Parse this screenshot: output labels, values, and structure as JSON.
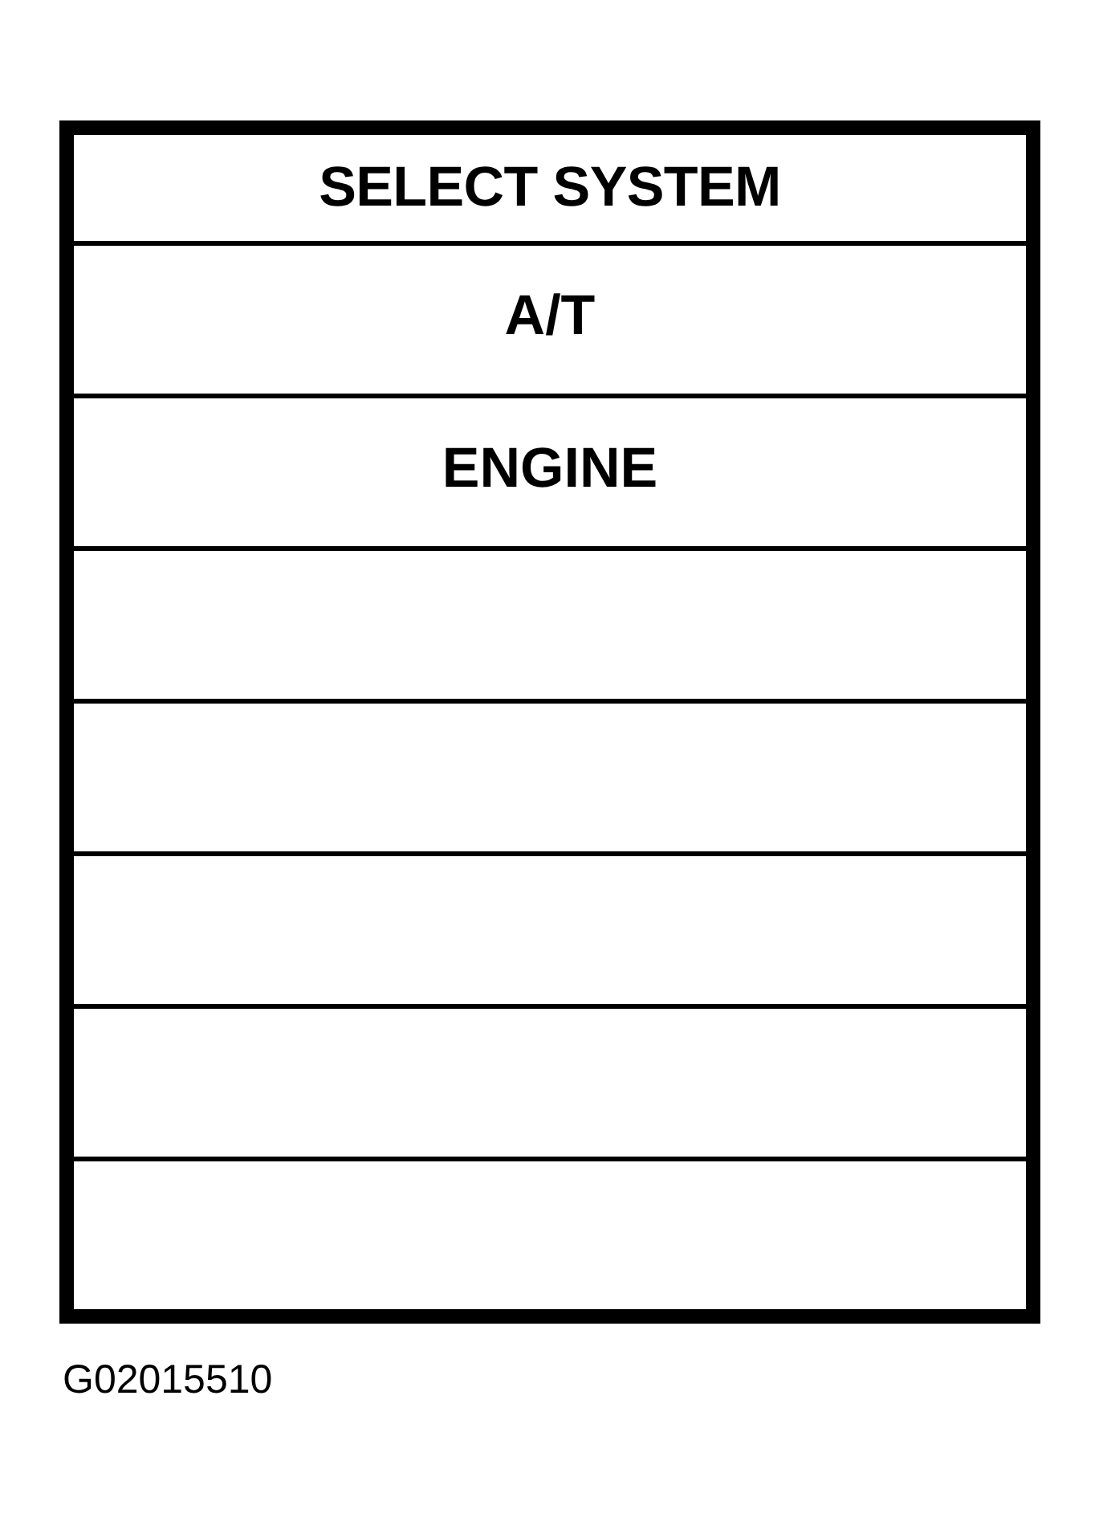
{
  "menu": {
    "title": "SELECT SYSTEM",
    "items": [
      {
        "kind": "option",
        "label": "A/T"
      },
      {
        "kind": "option",
        "label": "ENGINE"
      },
      {
        "kind": "blank"
      },
      {
        "kind": "blank"
      },
      {
        "kind": "blank"
      },
      {
        "kind": "blank"
      },
      {
        "kind": "blank"
      }
    ]
  },
  "figure_id": "G02015510"
}
